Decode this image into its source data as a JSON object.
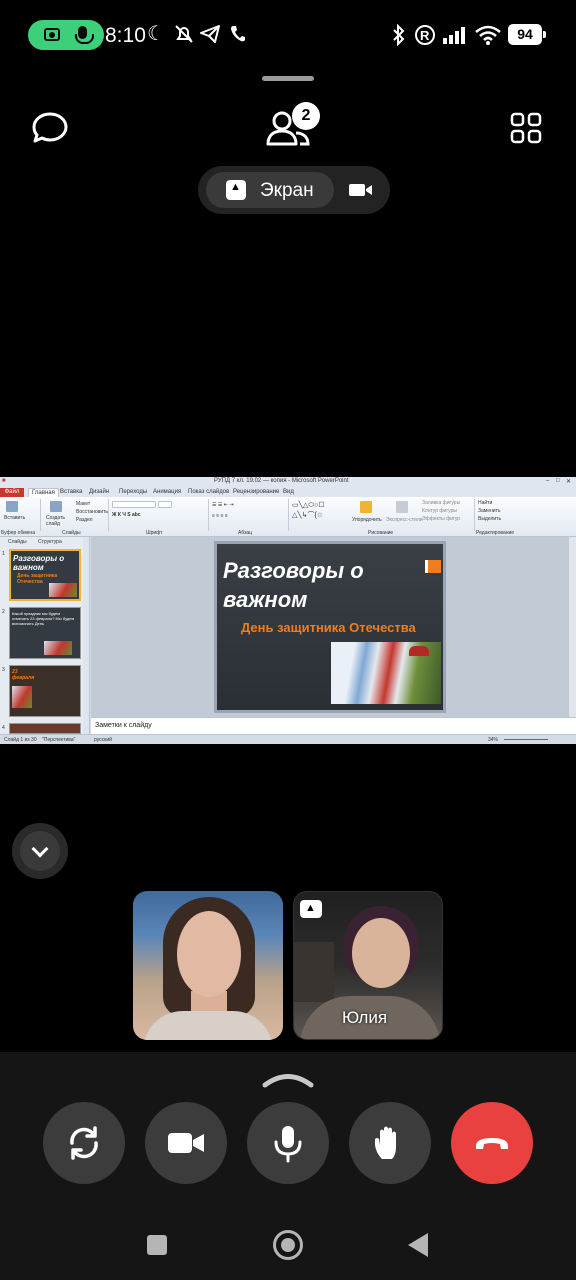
{
  "status_bar": {
    "time": "8:10",
    "battery": "94",
    "icons": [
      "camera-in-use-icon",
      "mic-in-use-icon",
      "moon-icon",
      "bell-off-icon",
      "telegram-icon",
      "phone-icon",
      "bluetooth-icon",
      "registered-icon",
      "signal-icon",
      "wifi-icon",
      "battery-icon"
    ]
  },
  "call_header": {
    "participants_count": "2",
    "icons": [
      "chat-icon",
      "participants-icon",
      "grid-icon"
    ]
  },
  "mode_switch": {
    "screen_label": "Экран",
    "icons": [
      "share-screen-icon",
      "video-icon"
    ]
  },
  "shared_screen": {
    "window_title": "РУПД 7 кл. 19.02 — копия - Microsoft PowerPoint",
    "file_tab": "Файл",
    "tabs": [
      "Главная",
      "Вставка",
      "Дизайн",
      "Переходы",
      "Анимация",
      "Показ слайдов",
      "Рецензирование",
      "Вид"
    ],
    "ribbon": {
      "paste": "Вставить",
      "clipboard": "Буфер обмена",
      "new_slide": "Создать слайд",
      "layout": "Макет",
      "reset": "Восстановить",
      "section": "Раздел",
      "slides_group": "Слайды",
      "font_group": "Шрифт",
      "paragraph_group": "Абзац",
      "arrange": "Упорядочить",
      "quick_styles": "Экспресс-стили",
      "shape_fill": "Заливка фигуры",
      "shape_outline": "Контур фигуры",
      "shape_effects": "Эффекты фигур",
      "drawing_group": "Рисование",
      "find": "Найти",
      "replace": "Заменить",
      "select": "Выделить",
      "editing_group": "Редактирование"
    },
    "left_tabs": [
      "Слайды",
      "Структура"
    ],
    "thumbnails": [
      {
        "num": "1",
        "title": "Разговоры о важном",
        "sub": "День защитника Отечества"
      },
      {
        "num": "2",
        "text": "Какой праздник мы будем отмечать 23 февраля? Мы будем вспоминать День"
      },
      {
        "num": "3",
        "title": "23 февраля"
      },
      {
        "num": "4",
        "title": ""
      }
    ],
    "slide": {
      "title": "Разговоры о важном",
      "subtitle": "День защитника Отечества"
    },
    "notes_placeholder": "Заметки к слайду",
    "status": {
      "slide_of": "Слайд 1 из 30",
      "theme": "\"Перспектива\"",
      "language": "русский",
      "zoom": "34%"
    }
  },
  "participants": [
    {
      "name": "",
      "sharing": false
    },
    {
      "name": "Юлия",
      "sharing": true
    }
  ],
  "controls": {
    "icons": [
      "switch-camera-icon",
      "camera-icon",
      "microphone-icon",
      "raise-hand-icon",
      "end-call-icon"
    ],
    "end_color": "#e8413f"
  },
  "navigation": {
    "icons": [
      "recents-icon",
      "home-icon",
      "back-icon"
    ]
  }
}
